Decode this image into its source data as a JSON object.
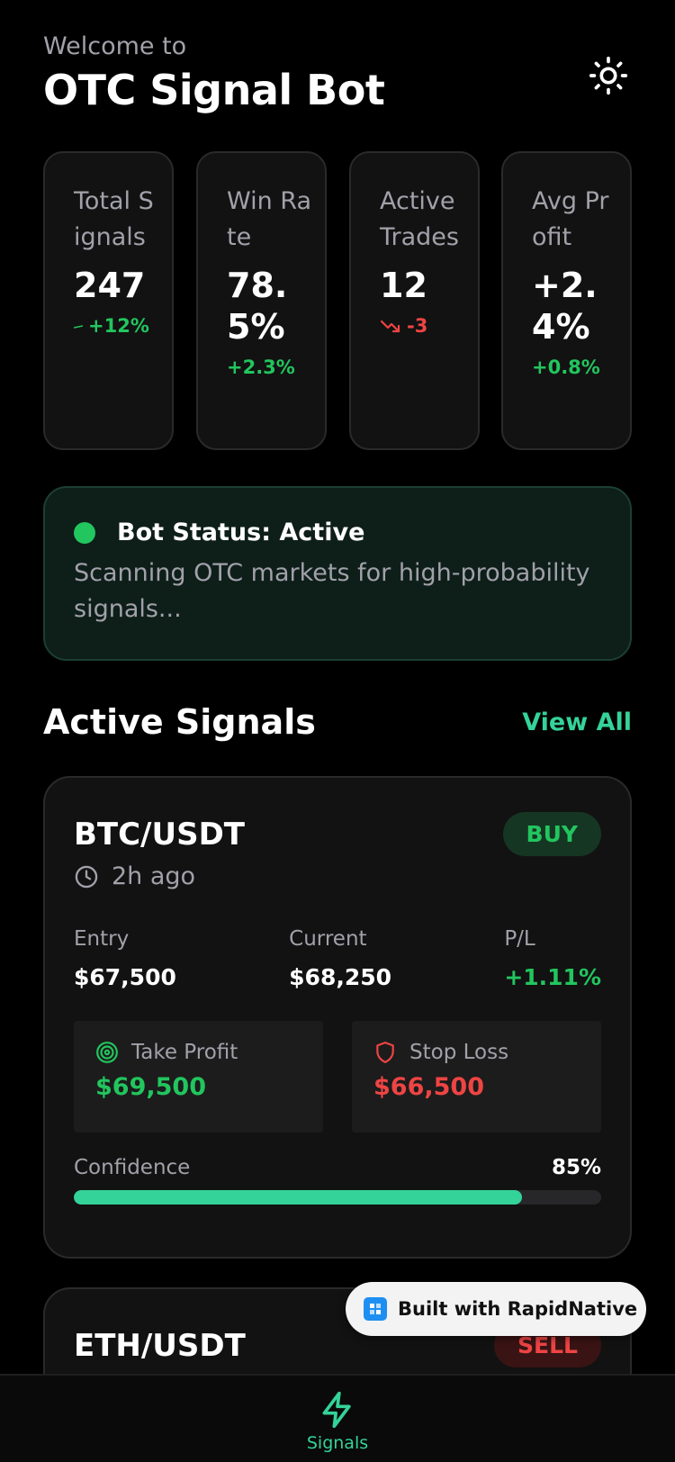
{
  "header": {
    "welcome": "Welcome to",
    "title": "OTC Signal Bot"
  },
  "stats": [
    {
      "label": "Total Signals",
      "value": "247",
      "change": "+12%",
      "trend": "up"
    },
    {
      "label": "Win Rate",
      "value": "78.5%",
      "change": "+2.3%",
      "trend": "up"
    },
    {
      "label": "Active Trades",
      "value": "12",
      "change": "-3",
      "trend": "down"
    },
    {
      "label": "Avg Profit",
      "value": "+2.4%",
      "change": "+0.8%",
      "trend": "up"
    }
  ],
  "bot_status": {
    "title": "Bot Status: Active",
    "description": "Scanning OTC markets for high-probability signals..."
  },
  "section": {
    "title": "Active Signals",
    "view_all": "View All"
  },
  "signals": [
    {
      "pair": "BTC/USDT",
      "action": "BUY",
      "time": "2h ago",
      "entry_label": "Entry",
      "entry": "$67,500",
      "current_label": "Current",
      "current": "$68,250",
      "pl_label": "P/L",
      "pl": "+1.11%",
      "take_profit_label": "Take Profit",
      "take_profit": "$69,500",
      "stop_loss_label": "Stop Loss",
      "stop_loss": "$66,500",
      "confidence_label": "Confidence",
      "confidence": "85%",
      "confidence_value": 85
    },
    {
      "pair": "ETH/USDT",
      "action": "SELL"
    }
  ],
  "watermark": {
    "label": "Built with RapidNative"
  },
  "nav": {
    "signals_label": "Signals"
  },
  "colors": {
    "accent": "#34d399",
    "positive": "#22c55e",
    "negative": "#ef4444",
    "background": "#000000",
    "card": "#121212"
  }
}
